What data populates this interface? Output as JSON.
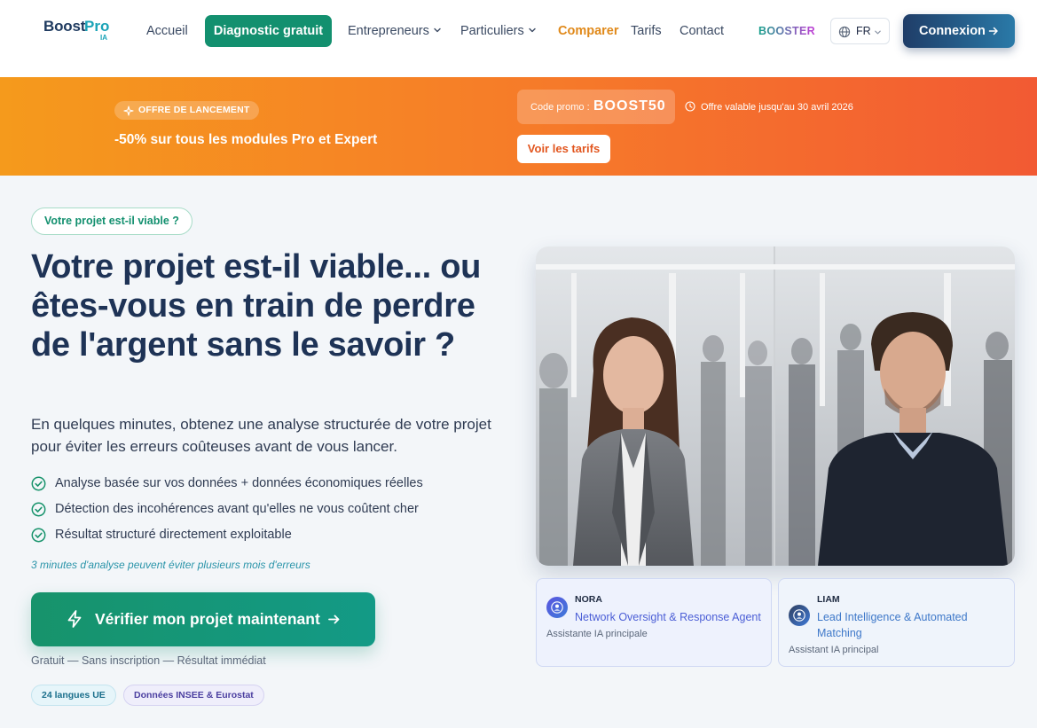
{
  "header": {
    "logo": {
      "boost": "Boost",
      "pro": "Pro",
      "ia": "IA"
    },
    "nav": {
      "accueil": "Accueil",
      "diagnostic": "Diagnostic gratuit",
      "entrepreneurs": "Entrepreneurs",
      "particuliers": "Particuliers",
      "comparer": "Comparer",
      "tarifs": "Tarifs",
      "contact": "Contact"
    },
    "booster": "BOOSTER",
    "language": "FR",
    "login": "Connexion"
  },
  "promo": {
    "badge": "OFFRE DE LANCEMENT",
    "text": "-50% sur tous les modules Pro et Expert",
    "code_label": "Code promo :",
    "code": "BOOST50",
    "validity": "Offre valable jusqu'au 30 avril 2026",
    "button": "Voir les tarifs"
  },
  "hero": {
    "badge": "Votre projet est-il viable ?",
    "title": "Votre projet est-il viable... ou êtes-vous en train de perdre de l'argent sans le savoir ?",
    "subtitle": "En quelques minutes, obtenez une analyse structurée de votre projet pour éviter les erreurs coûteuses avant de vous lancer.",
    "checks": [
      "Analyse basée sur vos données + données économiques réelles",
      "Détection des incohérences avant qu'elles ne vous coûtent cher",
      "Résultat structuré directement exploitable"
    ],
    "hint": "3 minutes d'analyse peuvent éviter plusieurs mois d'erreurs",
    "cta": "Vérifier mon projet maintenant",
    "cta_note": "Gratuit — Sans inscription — Résultat immédiat",
    "tags": [
      "24 langues UE",
      "Données INSEE & Eurostat"
    ]
  },
  "agents": [
    {
      "name": "NORA",
      "role": "Network Oversight & Response Agent",
      "desc": "Assistante IA principale"
    },
    {
      "name": "LIAM",
      "role": "Lead Intelligence & Automated Matching",
      "desc": "Assistant IA principal"
    }
  ],
  "colors": {
    "primary_green": "#13906f",
    "accent_orange": "#e0891a",
    "navy": "#1e3356",
    "promo_gradient_start": "#f59a1c",
    "promo_gradient_end": "#f25a33"
  },
  "icons": {
    "chevron": "chevron-down-icon",
    "globe": "globe-icon",
    "arrow": "arrow-right-icon",
    "spark": "sparkle-icon",
    "clock": "clock-icon",
    "check": "check-circle-icon",
    "bolt": "bolt-icon",
    "user": "user-icon"
  }
}
